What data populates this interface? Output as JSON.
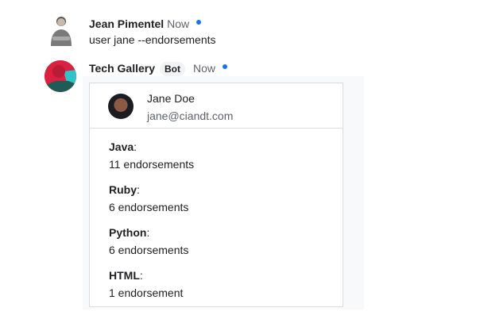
{
  "messages": [
    {
      "sender": "Jean Pimentel",
      "time": "Now",
      "text": "user jane --endorsements"
    },
    {
      "sender": "Tech Gallery",
      "badge": "Bot",
      "time": "Now"
    }
  ],
  "card": {
    "user": {
      "name": "Jane Doe",
      "email": "jane@ciandt.com"
    },
    "skills": [
      {
        "name": "Java",
        "count": "11 endorsements"
      },
      {
        "name": "Ruby",
        "count": "6 endorsements"
      },
      {
        "name": "Python",
        "count": "6 endorsements"
      },
      {
        "name": "HTML",
        "count": "1 endorsement"
      }
    ]
  },
  "colors": {
    "unread_dot": "#1a73e8",
    "bot_avatar": "#d9223f",
    "card_bg": "#f8f9fa"
  }
}
